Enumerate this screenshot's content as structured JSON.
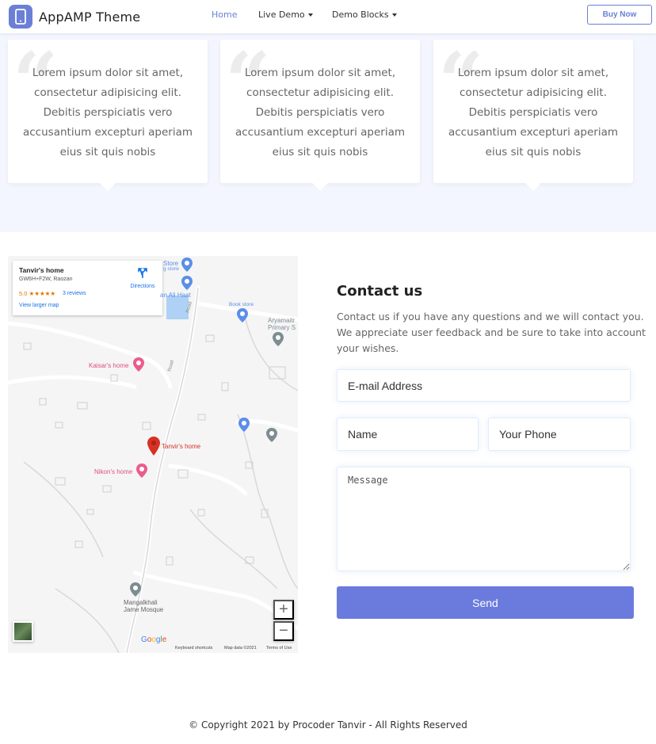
{
  "nav": {
    "brand": "AppAMP Theme",
    "items": [
      {
        "label": "Home",
        "active": true
      },
      {
        "label": "Live Demo",
        "dropdown": true
      },
      {
        "label": "Demo Blocks",
        "dropdown": true
      }
    ],
    "buy_label": "Buy Now",
    "accent": "#6b7fd7"
  },
  "testimonials": [
    {
      "text": "Lorem ipsum dolor sit amet, consectetur adipisicing elit. Debitis perspiciatis vero accusantium excepturi aperiam eius sit quis nobis"
    },
    {
      "text": "Lorem ipsum dolor sit amet, consectetur adipisicing elit. Debitis perspiciatis vero accusantium excepturi aperiam eius sit quis nobis"
    },
    {
      "text": "Lorem ipsum dolor sit amet, consectetur adipisicing elit. Debitis perspiciatis vero accusantium excepturi aperiam eius sit quis nobis"
    }
  ],
  "map": {
    "infobox": {
      "title": "Tanvir's home",
      "address": "GW6H+F2W, Raozan",
      "rating": "5.0 ★★★★★",
      "reviews": "3 reviews",
      "larger_map": "View larger map",
      "directions": "Directions"
    },
    "labels": {
      "store": "Store",
      "store2": "g store",
      "ali_haat": "an Ali Haat",
      "book_store": "Book store",
      "aryamaitri": "Aryamaitr",
      "primary": "Primary S",
      "kaisar": "Kaisar's home",
      "tanvir": "Tanvir's home",
      "nikon": "Nikon's home",
      "mosque1": "Mangalkhali",
      "mosque2": "Jame Mosque",
      "road": "Road"
    },
    "zoom_in": "+",
    "zoom_out": "−",
    "keyboard": "Keyboard shortcuts",
    "map_data": "Map data ©2021",
    "terms": "Terms of Use"
  },
  "contact": {
    "title": "Contact us",
    "description": "Contact us if you have any questions and we will contact you. We appreciate user feedback and be sure to take into account your wishes.",
    "email_placeholder": "E-mail Address",
    "name_placeholder": "Name",
    "phone_placeholder": "Your Phone",
    "message_placeholder": "Message",
    "send_label": "Send",
    "button_color": "#6b7bdd"
  },
  "footer": {
    "copyright": "© Copyright 2021 by Procoder Tanvir - All Rights Reserved"
  }
}
